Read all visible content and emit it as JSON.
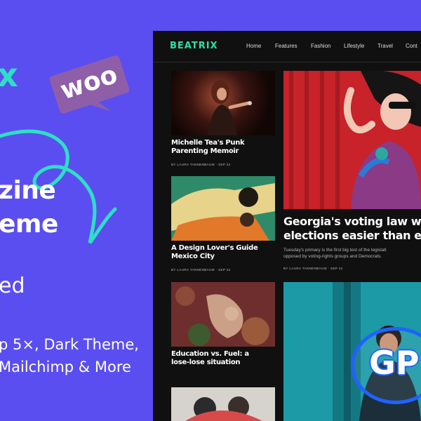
{
  "promo": {
    "logo_mark": "x",
    "woo_badge": "woo",
    "headline_line1": "zine",
    "headline_line2": "eme",
    "subtitle": "ed",
    "features_line1": "p 5×, Dark Theme,",
    "features_line2": "Mailchimp & More"
  },
  "site": {
    "brand": "BEATRIX",
    "nav": [
      "Home",
      "Features",
      "Fashion",
      "Lifestyle",
      "Travel",
      "Cont"
    ]
  },
  "articles": [
    {
      "title": "Michelle Tea's Punk\nParenting Memoir",
      "meta": "BY LAURA TANNENBAUM · SEP 22"
    },
    {
      "title": "A Design Lover's Guide\nMexico City",
      "meta": "BY LAURA TANNENBAUM · SEP 22"
    },
    {
      "title": "Education vs. Fuel: a\nlose-lose situation",
      "meta": ""
    }
  ],
  "featured": {
    "title": "Georgia's voting law will r\nelections easier than eve",
    "excerpt": "Tuesday's primary is the first big test of the legislati\nopposed by voting-rights groups and Democrats.",
    "meta": "BY LAURA TANNENBAUM · SEP 22"
  },
  "badge": {
    "gpl": "GP"
  },
  "colors": {
    "background": "#5b4ef0",
    "accent": "#2de0c4",
    "woo": "#8e5ea8",
    "gpl_ring": "#1f63ff"
  }
}
